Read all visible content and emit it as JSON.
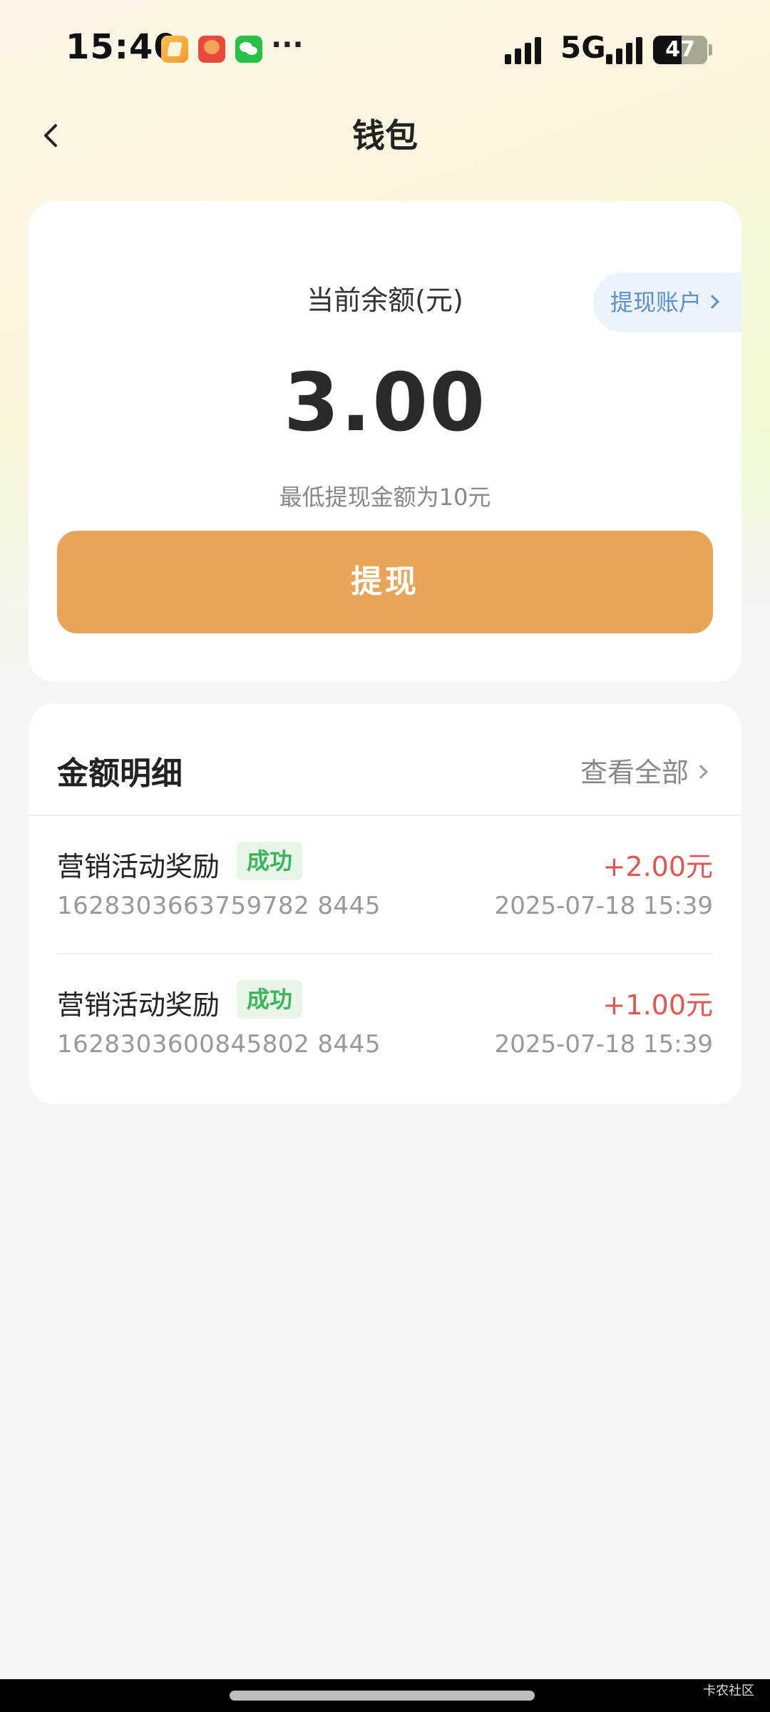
{
  "status_bar": {
    "time": "15:40",
    "notification_icons": [
      "notes-app-icon",
      "game-app-icon",
      "wechat-icon"
    ],
    "more": "···",
    "network": "5G",
    "battery": "47"
  },
  "nav": {
    "back_icon": "chevron-left-icon",
    "title": "钱包"
  },
  "balance": {
    "label": "当前余额(元)",
    "amount": "3.00",
    "withdraw_account_label": "提现账户",
    "min_hint": "最低提现金额为10元",
    "withdraw_button_label": "提现"
  },
  "details": {
    "title": "金额明细",
    "view_all_label": "查看全部",
    "records": [
      {
        "name": "营销活动奖励",
        "status": "成功",
        "amount": "+2.00元",
        "id": "1628303663759782 8445",
        "time": "2025-07-18 15:39"
      },
      {
        "name": "营销活动奖励",
        "status": "成功",
        "amount": "+1.00元",
        "id": "1628303600845802 8445",
        "time": "2025-07-18 15:39"
      }
    ]
  },
  "watermark": "卡农社区",
  "colors": {
    "accent_orange": "#e9a557",
    "success_green": "#3cb55a",
    "amount_red": "#e1564f",
    "link_blue": "#5b8fd4"
  }
}
